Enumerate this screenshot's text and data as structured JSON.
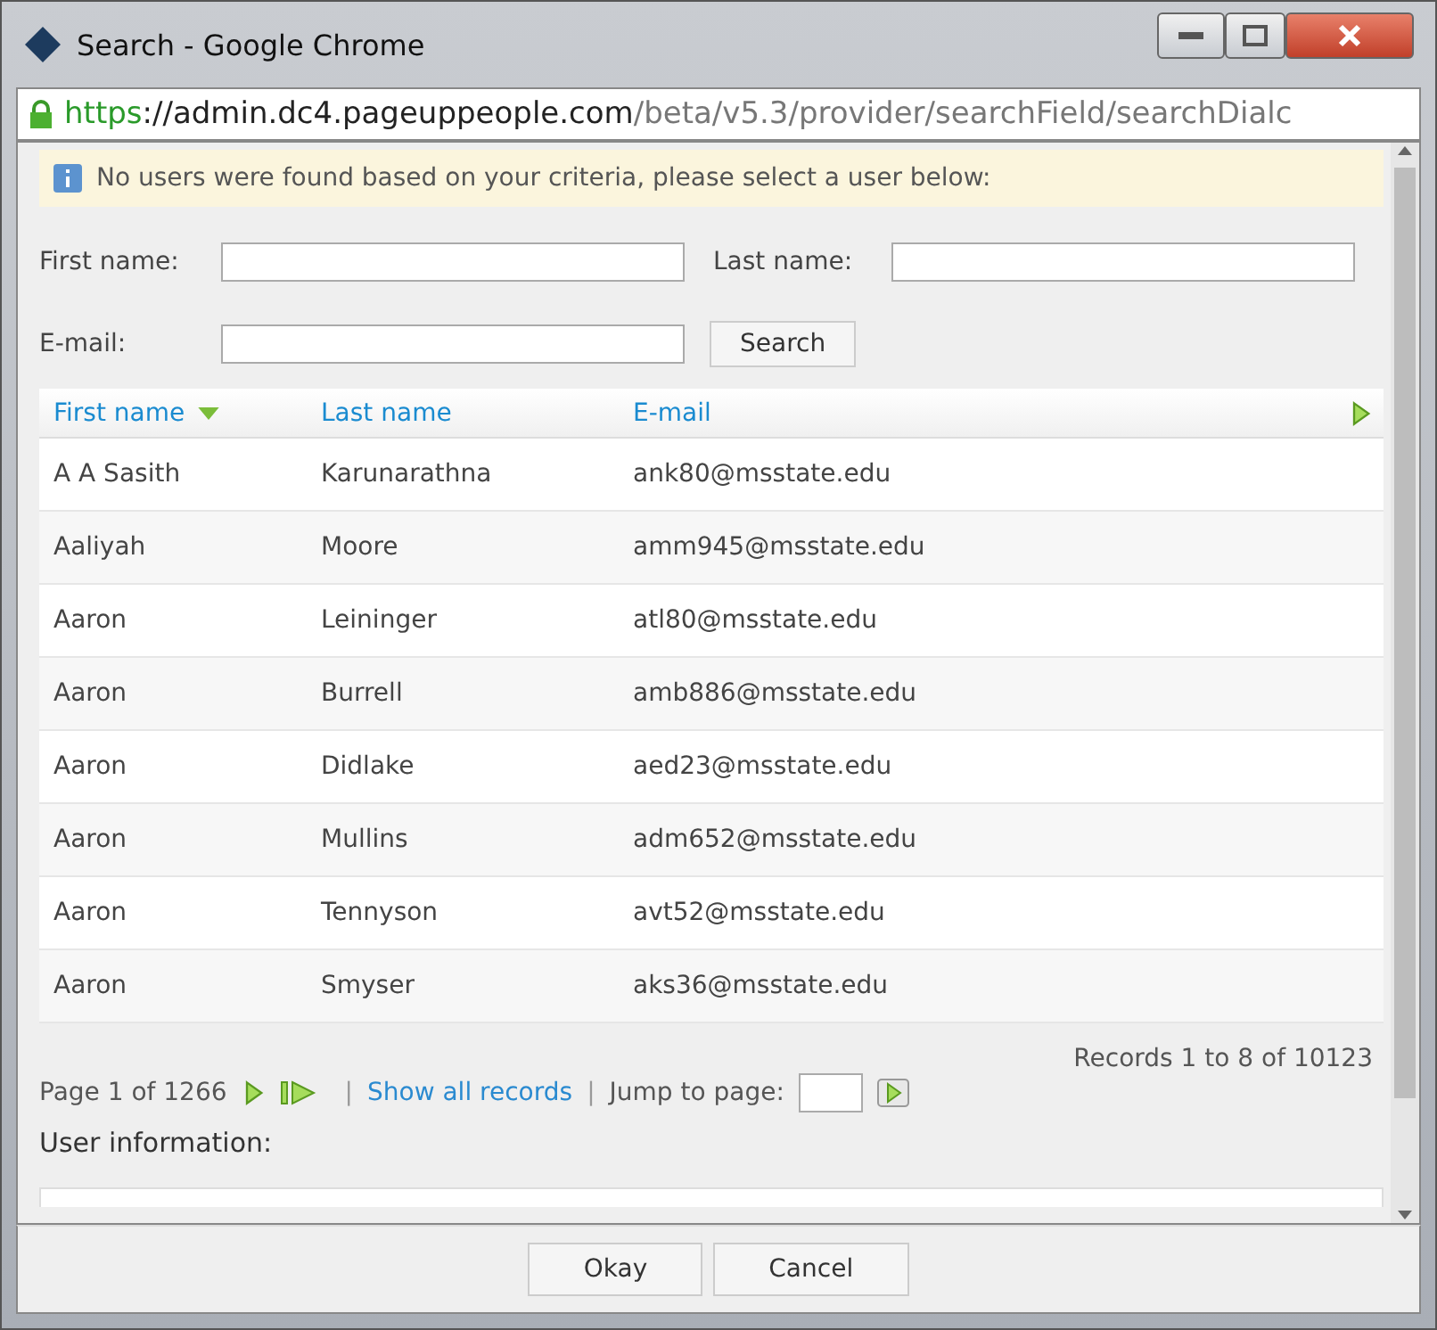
{
  "window": {
    "title": "Search - Google Chrome"
  },
  "address_bar": {
    "scheme": "https",
    "host": "://admin.dc4.pageuppeople.com",
    "path": "/beta/v5.3/provider/searchField/searchDialc"
  },
  "notice": "No users were found based on your criteria, please select a user below:",
  "form": {
    "first_name_label": "First name:",
    "last_name_label": "Last name:",
    "email_label": "E-mail:",
    "search_button": "Search"
  },
  "table": {
    "columns": [
      {
        "label": "First name",
        "sorted": true
      },
      {
        "label": "Last name",
        "sorted": false
      },
      {
        "label": "E-mail",
        "sorted": false
      }
    ],
    "rows": [
      {
        "first": "A A Sasith",
        "last": "Karunarathna",
        "email": "ank80@msstate.edu"
      },
      {
        "first": "Aaliyah",
        "last": "Moore",
        "email": "amm945@msstate.edu"
      },
      {
        "first": "Aaron",
        "last": "Leininger",
        "email": "atl80@msstate.edu"
      },
      {
        "first": "Aaron",
        "last": "Burrell",
        "email": "amb886@msstate.edu"
      },
      {
        "first": "Aaron",
        "last": "Didlake",
        "email": "aed23@msstate.edu"
      },
      {
        "first": "Aaron",
        "last": "Mullins",
        "email": "adm652@msstate.edu"
      },
      {
        "first": "Aaron",
        "last": "Tennyson",
        "email": "avt52@msstate.edu"
      },
      {
        "first": "Aaron",
        "last": "Smyser",
        "email": "aks36@msstate.edu"
      }
    ]
  },
  "pager": {
    "records": "Records 1 to 8 of 10123",
    "page": "Page 1 of 1266",
    "separators": [
      "|",
      "|"
    ],
    "show_all": "Show all records",
    "jump_label": "Jump to page:"
  },
  "user_information_label": "User information:",
  "buttons": [
    "Okay",
    "Cancel"
  ]
}
